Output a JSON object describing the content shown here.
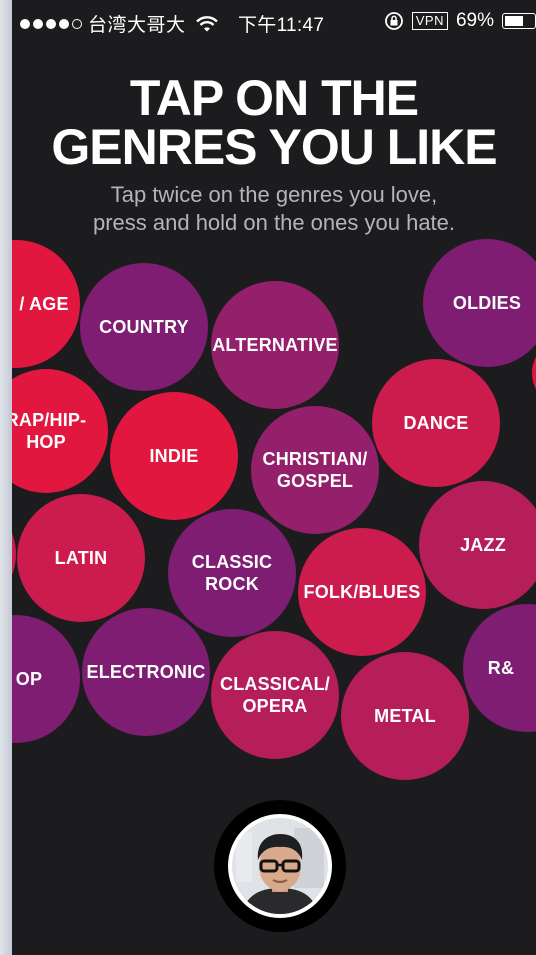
{
  "status_bar": {
    "carrier": "台湾大哥大",
    "time": "下午11:47",
    "vpn": "VPN",
    "battery": "69%",
    "battery_level": 0.69
  },
  "header": {
    "title_line1": "TAP ON THE",
    "title_line2": "GENRES YOU LIKE",
    "subtitle_line1": "Tap twice on the genres you love,",
    "subtitle_line2": "press and hold on the ones you hate."
  },
  "genres": [
    {
      "label": "/ AGE"
    },
    {
      "label": "COUNTRY"
    },
    {
      "label": "ALTERNATIVE"
    },
    {
      "label": "OLDIES"
    },
    {
      "label": "RAP/HIP-\nHOP"
    },
    {
      "label": "INDIE"
    },
    {
      "label": "CHRISTIAN/\nGOSPEL"
    },
    {
      "label": "DANCE"
    },
    {
      "label": "LATIN"
    },
    {
      "label": "CLASSIC\nROCK"
    },
    {
      "label": "FOLK/BLUES"
    },
    {
      "label": "JAZZ"
    },
    {
      "label": "OP"
    },
    {
      "label": "ELECTRONIC"
    },
    {
      "label": "CLASSICAL/\nOPERA"
    },
    {
      "label": "METAL"
    },
    {
      "label": "R&"
    }
  ],
  "colors": {
    "background": "#1c1c1e",
    "red": "#e2173f",
    "crimson": "#cc1b4d",
    "rose": "#b51e59",
    "plum": "#941f6a",
    "violet": "#7e1d72"
  }
}
